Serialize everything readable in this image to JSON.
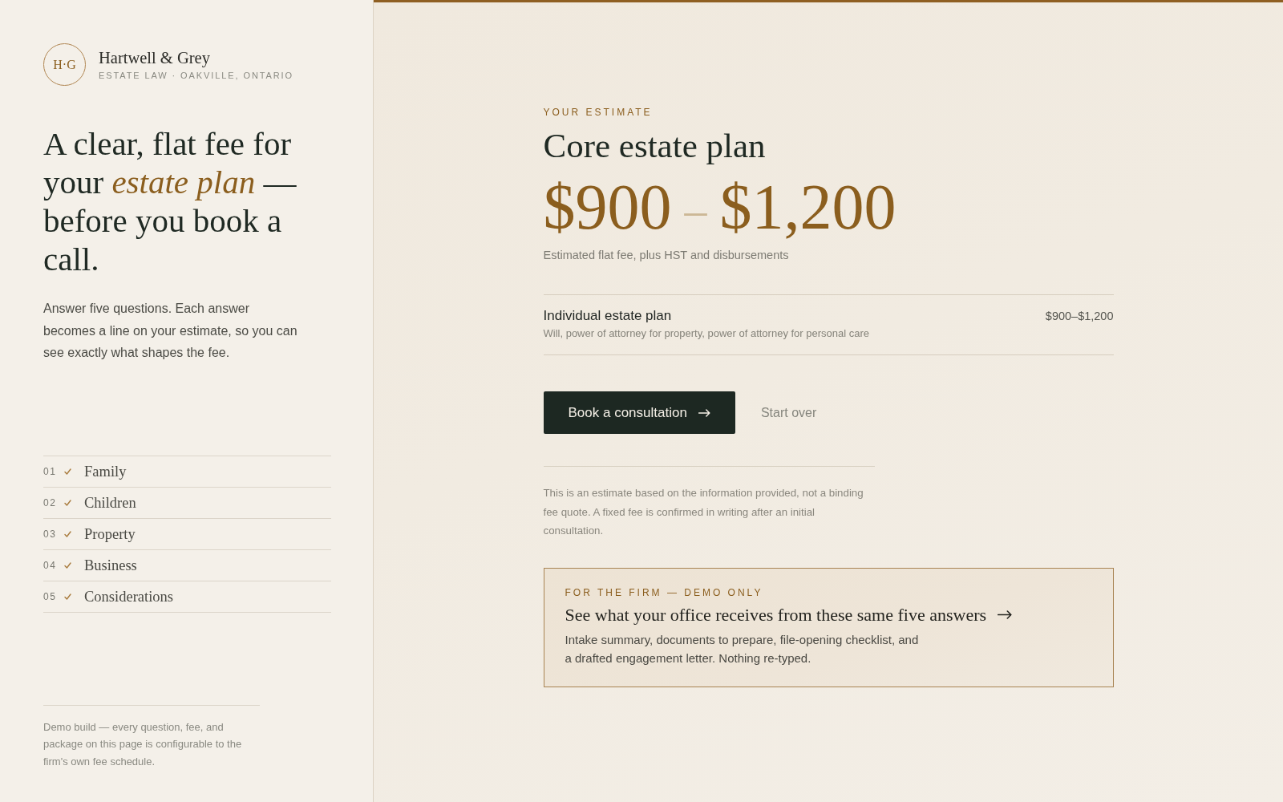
{
  "brand": {
    "monogram": "H·G",
    "name": "Hartwell & Grey",
    "tagline": "ESTATE LAW · OAKVILLE, ONTARIO"
  },
  "intro": {
    "heading": "A clear, flat fee for your *estate plan* — before you book a call.",
    "text": "Answer five questions. Each answer becomes a line on your estimate, so you can see exactly what shapes the fee."
  },
  "steps": [
    {
      "number": "01",
      "label": "Family",
      "done": true
    },
    {
      "number": "02",
      "label": "Children",
      "done": true
    },
    {
      "number": "03",
      "label": "Property",
      "done": true
    },
    {
      "number": "04",
      "label": "Business",
      "done": true
    },
    {
      "number": "05",
      "label": "Considerations",
      "done": true
    }
  ],
  "footnote": "Demo build — every question, fee, and package on this page is configurable to the firm's own fee schedule.",
  "estimate": {
    "eyebrow": "YOUR ESTIMATE",
    "title": "Core estate plan",
    "price_low": "$900",
    "price_separator": "–",
    "price_high": "$1,200",
    "note": "Estimated flat fee, plus HST and disbursements",
    "line_items": [
      {
        "name": "Individual estate plan",
        "detail": "Will, power of attorney for property, power of attorney for personal care",
        "amount": "$900–$1,200"
      }
    ]
  },
  "actions": {
    "primary": "Book a consultation",
    "secondary": "Start over"
  },
  "disclaimer": "This is an estimate based on the information provided, not a binding fee quote. A fixed fee is confirmed in writing after an initial consultation.",
  "firm_card": {
    "eyebrow": "FOR THE FIRM — DEMO ONLY",
    "title": "See what your office receives from these same five answers",
    "text": "Intake summary, documents to prepare, file-opening checklist, and a drafted engagement letter. Nothing re-typed."
  }
}
